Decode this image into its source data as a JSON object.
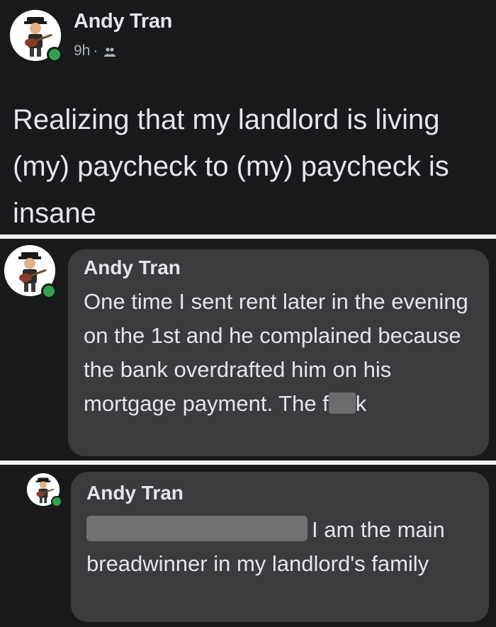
{
  "post": {
    "author": "Andy Tran",
    "time": "9h",
    "separator": "·",
    "audience_icon": "friends-icon",
    "text": "Realizing that my landlord is living (my) paycheck to (my) paycheck is insane"
  },
  "comments": [
    {
      "author": "Andy Tran",
      "text_before": "One time I sent rent later in the evening on the 1st and he complained because the bank overdrafted him on his mortgage payment. The f",
      "text_after": "k"
    },
    {
      "author": "Andy Tran",
      "text": "I am the main breadwinner in my landlord's family"
    }
  ],
  "colors": {
    "panel_bg": "#18191a",
    "bubble_bg": "#3a3b3c",
    "text": "#e4e6eb",
    "meta_text": "#b0b3b8",
    "online": "#31a24c"
  }
}
